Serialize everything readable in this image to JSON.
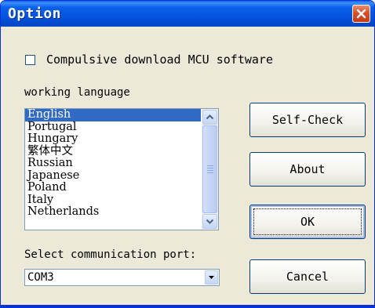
{
  "window": {
    "title": "Option",
    "close_icon": "close-icon"
  },
  "options": {
    "compulsive_download_label": "Compulsive download MCU software",
    "compulsive_download_checked": false
  },
  "language": {
    "label": "working language",
    "items": [
      "English",
      "Portugal",
      "Hungary",
      "繁体中文",
      "Russian",
      "Japanese",
      "Poland",
      "Italy",
      "Netherlands"
    ],
    "selected": "English"
  },
  "port": {
    "label": "Select communication port:",
    "value": "COM3"
  },
  "buttons": {
    "self_check": "Self-Check",
    "about": "About",
    "ok": "OK",
    "cancel": "Cancel"
  },
  "colors": {
    "titlebar": "#0654df",
    "selection": "#316ac5",
    "dialog_bg": "#ece9d8"
  }
}
